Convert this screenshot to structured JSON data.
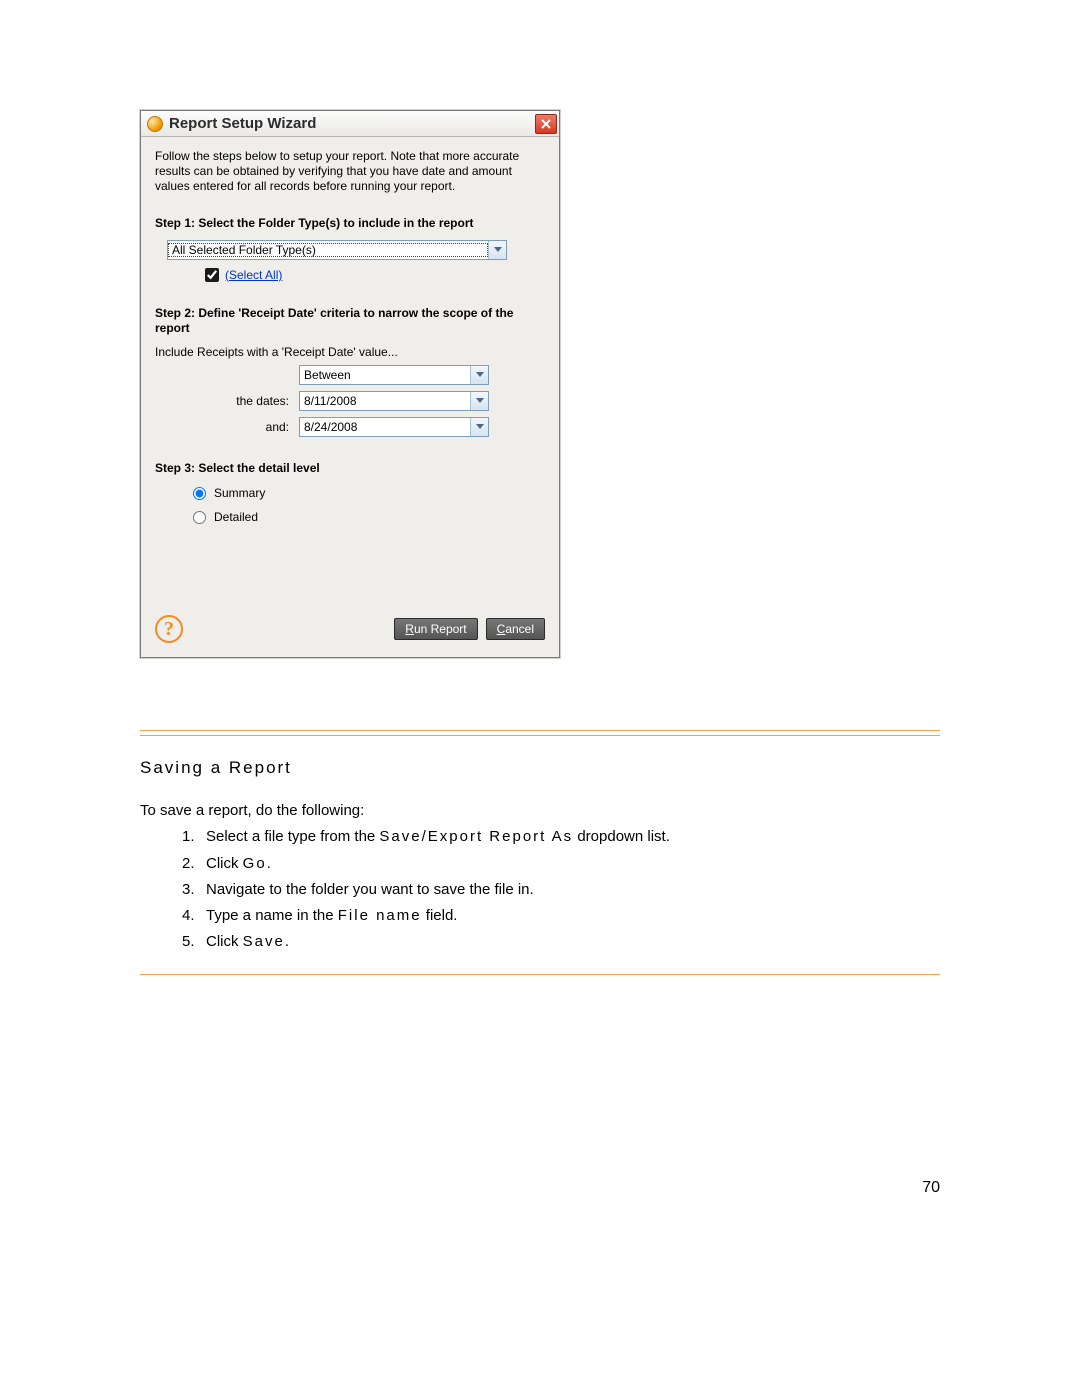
{
  "dialog": {
    "title": "Report Setup Wizard",
    "intro": "Follow the steps below to setup your report.  Note that more accurate results can be obtained by verifying that you have date and amount values entered for all records before running your report.",
    "step1": {
      "heading": "Step 1: Select the Folder Type(s) to include in the report",
      "combo_value": "All Selected Folder Type(s)",
      "select_all": "(Select All)"
    },
    "step2": {
      "heading": "Step 2: Define 'Receipt Date' criteria to narrow the scope of the report",
      "intro": "Include Receipts with a 'Receipt Date' value...",
      "operator": "Between",
      "dates_label": "the dates:",
      "date_from": "8/11/2008",
      "and_label": "and:",
      "date_to": "8/24/2008"
    },
    "step3": {
      "heading": "Step 3: Select the detail level",
      "summary": "Summary",
      "detailed": "Detailed"
    },
    "buttons": {
      "run_prefix": "R",
      "run_rest": "un Report",
      "cancel_prefix": "C",
      "cancel_rest": "ancel"
    }
  },
  "doc": {
    "heading": "Saving a Report",
    "lead": "To save a report, do the following:",
    "items": {
      "i1_a": "Select a file type from the ",
      "i1_b": "Save/Export Report As",
      "i1_c": " dropdown list.",
      "i2_a": "Click ",
      "i2_b": "Go",
      "i2_c": ".",
      "i3": "Navigate to the folder you want to save the file in.",
      "i4_a": "Type a name in the ",
      "i4_b": "File name",
      "i4_c": " field.",
      "i5_a": "Click ",
      "i5_b": "Save",
      "i5_c": "."
    },
    "page_number": "70"
  }
}
